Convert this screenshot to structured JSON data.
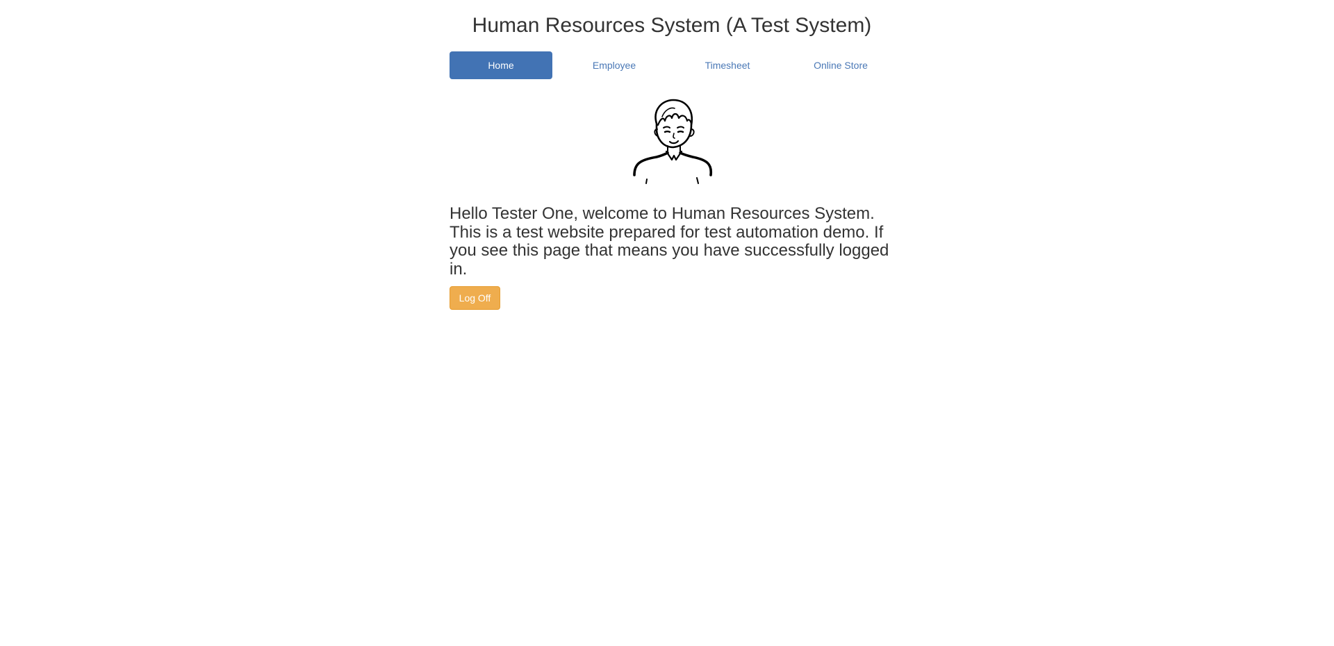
{
  "header": {
    "title": "Human Resources System (A Test System)"
  },
  "nav": {
    "items": [
      {
        "label": "Home",
        "active": true
      },
      {
        "label": "Employee",
        "active": false
      },
      {
        "label": "Timesheet",
        "active": false
      },
      {
        "label": "Online Store",
        "active": false
      }
    ]
  },
  "main": {
    "avatar_icon": "user-cartoon-avatar",
    "welcome_text": "Hello Tester One, welcome to Human Resources System. This is a test website prepared for test automation demo. If you see this page that means you have successfully logged in.",
    "logoff_label": "Log Off"
  },
  "colors": {
    "primary": "#4273b4",
    "link": "#4a78b6",
    "warning": "#efad4e",
    "text": "#333333"
  }
}
